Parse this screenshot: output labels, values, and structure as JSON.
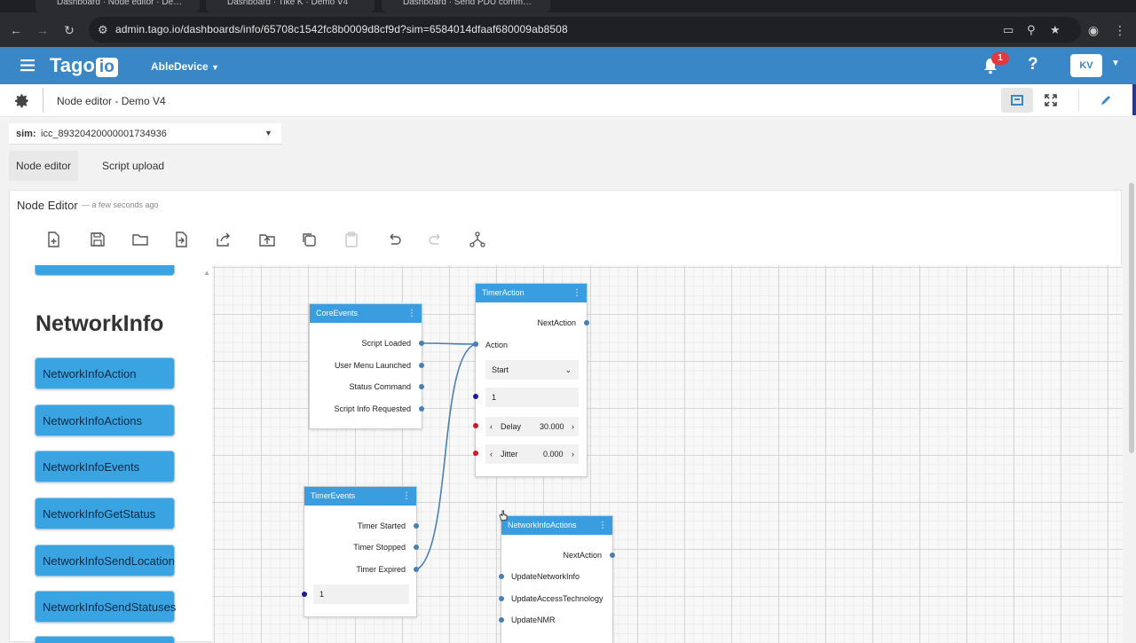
{
  "browser": {
    "tabs": [
      "Dashboard · Node editor · De…",
      "Dashboard · Tike K · Demo V4",
      "Dashboard · Send PDU comm…"
    ],
    "url": "admin.tago.io/dashboards/info/65708c1542fc8b0009d8cf9d?sim=6584014dfaaf680009ab8508"
  },
  "app": {
    "logo_text": "Tago",
    "logo_badge": "io",
    "profile_name": "AbleDevice",
    "notification_count": "1",
    "avatar_initials": "KV",
    "help_glyph": "?"
  },
  "dashboard": {
    "title": "Node editor - Demo V4"
  },
  "filter": {
    "label": "sim:",
    "value": "icc_89320420000001734936"
  },
  "tabs": {
    "node_editor": "Node editor",
    "script_upload": "Script upload"
  },
  "widget": {
    "title": "Node Editor",
    "updated": "— a few seconds ago"
  },
  "palette": {
    "heading": "NetworkInfo",
    "items": [
      "NetworkInfoAction",
      "NetworkInfoActions",
      "NetworkInfoEvents",
      "NetworkInfoGetStatus",
      "NetworkInfoSendLocation",
      "NetworkInfoSendStatuses"
    ]
  },
  "nodes": {
    "core_events": {
      "title": "CoreEvents",
      "outputs": [
        "Script Loaded",
        "User Menu Launched",
        "Status Command",
        "Script Info Requested"
      ]
    },
    "timer_action": {
      "title": "TimerAction",
      "output": "NextAction",
      "action_label": "Action",
      "select_value": "Start",
      "count_value": "1",
      "delay_label": "Delay",
      "delay_value": "30.000",
      "jitter_label": "Jitter",
      "jitter_value": "0.000"
    },
    "timer_events": {
      "title": "TimerEvents",
      "outputs": [
        "Timer Started",
        "Timer Stopped",
        "Timer Expired"
      ],
      "count_value": "1"
    },
    "network_info_actions": {
      "title": "NetworkInfoActions",
      "output": "NextAction",
      "inputs": [
        "UpdateNetworkInfo",
        "UpdateAccessTechnology",
        "UpdateNMR"
      ]
    }
  },
  "colors": {
    "header": "#3a87c8",
    "node_header": "#3a9de0",
    "palette_item": "#3aa4e2",
    "badge": "#e0393e"
  }
}
